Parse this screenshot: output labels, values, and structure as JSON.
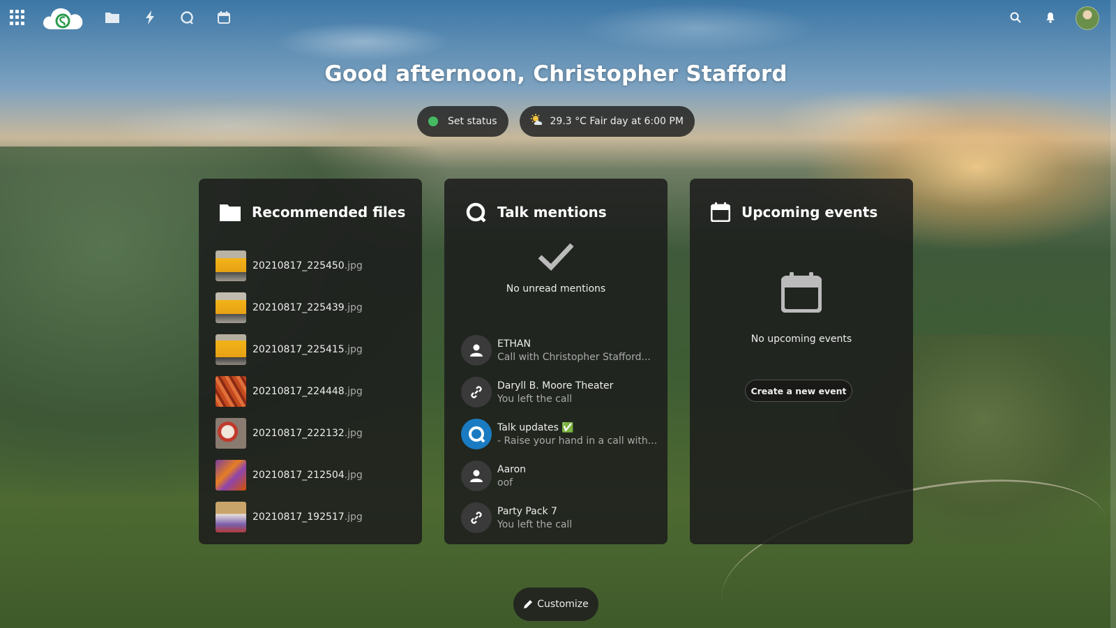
{
  "header": {
    "nav": [
      {
        "name": "files-icon"
      },
      {
        "name": "activity-icon"
      },
      {
        "name": "talk-icon"
      },
      {
        "name": "calendar-icon"
      }
    ]
  },
  "greeting": "Good afternoon, Christopher Stafford",
  "status": {
    "set_status_label": "Set status",
    "status_color": "#46ba61",
    "weather_text": "29.3 °C Fair day at 6:00 PM"
  },
  "recommended_files": {
    "title": "Recommended files",
    "files": [
      {
        "name": "20210817_225450",
        "ext": ".jpg"
      },
      {
        "name": "20210817_225439",
        "ext": ".jpg"
      },
      {
        "name": "20210817_225415",
        "ext": ".jpg"
      },
      {
        "name": "20210817_224448",
        "ext": ".jpg"
      },
      {
        "name": "20210817_222132",
        "ext": ".jpg"
      },
      {
        "name": "20210817_212504",
        "ext": ".jpg"
      },
      {
        "name": "20210817_192517",
        "ext": ".jpg"
      }
    ]
  },
  "talk": {
    "title": "Talk mentions",
    "empty_message": "No unread mentions",
    "mentions": [
      {
        "title": "ETHAN",
        "subtitle": "Call with Christopher Stafford...",
        "icon": "user-icon"
      },
      {
        "title": "Daryll B. Moore Theater",
        "subtitle": "You left the call",
        "icon": "link-icon"
      },
      {
        "title": "Talk updates ✅",
        "subtitle": "- Raise your hand in a call with...",
        "icon": "talk-icon"
      },
      {
        "title": "Aaron",
        "subtitle": "oof",
        "icon": "user-icon"
      },
      {
        "title": "Party Pack 7",
        "subtitle": "You left the call",
        "icon": "link-icon"
      }
    ]
  },
  "events": {
    "title": "Upcoming events",
    "empty_message": "No upcoming events",
    "create_label": "Create a new event"
  },
  "customize_label": "Customize"
}
